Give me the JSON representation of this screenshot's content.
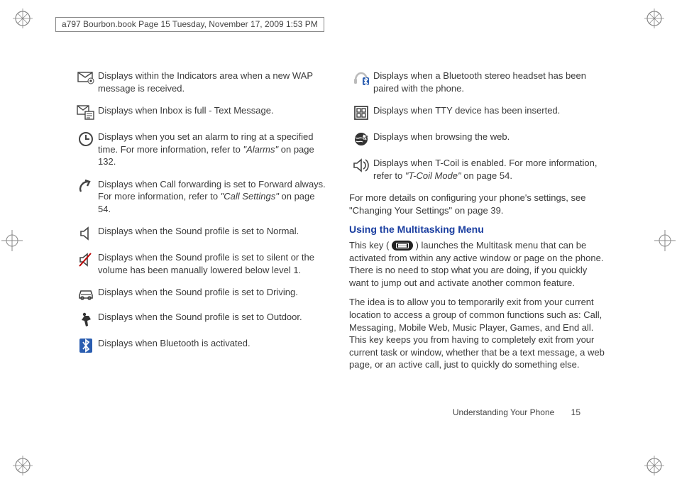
{
  "header_line": "a797 Bourbon.book  Page 15  Tuesday, November 17, 2009  1:53 PM",
  "left_items": [
    {
      "icon": "wap-message-icon",
      "text": "Displays within the Indicators area when a new WAP message is received."
    },
    {
      "icon": "inbox-full-icon",
      "text": "Displays when Inbox is full - Text Message."
    },
    {
      "icon": "alarm-clock-icon",
      "text_pre": "Displays when you set an alarm to ring at a specified time. For more information, refer to ",
      "ital": "\"Alarms\"",
      "text_post": "  on page 132."
    },
    {
      "icon": "call-forward-icon",
      "text_pre": "Displays when Call forwarding is set to Forward always. For more information, refer to ",
      "ital": "\"Call Settings\"",
      "text_post": "  on page 54."
    },
    {
      "icon": "sound-normal-icon",
      "text": "Displays when the Sound profile is set to Normal."
    },
    {
      "icon": "sound-silent-icon",
      "text": "Displays when the Sound profile is set to silent or the volume has been manually lowered below level 1."
    },
    {
      "icon": "sound-driving-icon",
      "text": "Displays when the Sound profile is set to Driving."
    },
    {
      "icon": "sound-outdoor-icon",
      "text": "Displays when the Sound profile is set to Outdoor."
    },
    {
      "icon": "bluetooth-icon",
      "text": "Displays when Bluetooth is activated."
    }
  ],
  "right_items": [
    {
      "icon": "bt-headset-icon",
      "text": "Displays when a Bluetooth stereo headset has been paired with the phone."
    },
    {
      "icon": "tty-icon",
      "text": "Displays when TTY device has been inserted."
    },
    {
      "icon": "web-browse-icon",
      "text": "Displays when browsing the web."
    },
    {
      "icon": "tcoil-icon",
      "text_pre": "Displays when T-Coil is enabled. For more information, refer to ",
      "ital": "\"T-Coil Mode\"",
      "text_post": "  on page 54."
    }
  ],
  "config_para_pre": "For more details on configuring your phone's settings, see ",
  "config_para_ital": "\"Changing Your Settings\"",
  "config_para_post": " on page 39.",
  "section_heading": "Using the Multitasking Menu",
  "multi_p1_pre": "This key ( ",
  "multi_p1_post": " ) launches the Multitask menu that can be activated from within any active window or page on the phone. There is no need to stop what you are doing, if you quickly want to jump out and activate another common feature.",
  "multi_p2": "The idea is to allow you to temporarily exit from your current location to access a group of common functions such as: Call, Messaging, Mobile Web, Music Player, Games, and End all. This key keeps you from having to completely exit from your current task or window, whether that be a text message, a web page, or an active call, just to quickly do something else.",
  "footer_section": "Understanding Your Phone",
  "footer_page": "15"
}
